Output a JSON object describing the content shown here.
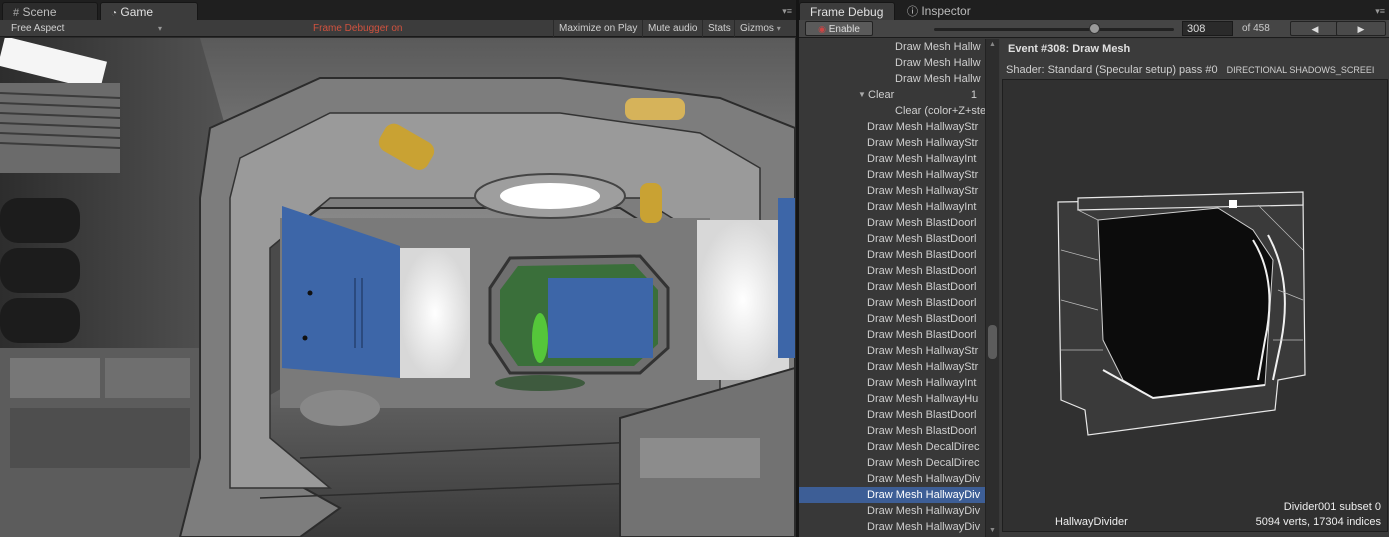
{
  "left_tabs": {
    "scene": "Scene",
    "game": "Game"
  },
  "game_toolbar": {
    "aspect": "Free Aspect",
    "status": "Frame Debugger on",
    "maximize": "Maximize on Play",
    "mute": "Mute audio",
    "stats": "Stats",
    "gizmos": "Gizmos"
  },
  "right_tabs": {
    "frame_debug": "Frame Debug",
    "inspector": "Inspector"
  },
  "fd_toolbar": {
    "enable": "Enable",
    "event_index": "308",
    "of_total": "of 458",
    "slider_position": 0.672
  },
  "tree_rows": [
    {
      "label": "Draw Mesh Hallw",
      "indent": 2,
      "count": ""
    },
    {
      "label": "Draw Mesh Hallw",
      "indent": 2,
      "count": ""
    },
    {
      "label": "Draw Mesh Hallw",
      "indent": 2,
      "count": ""
    },
    {
      "label": "Clear",
      "indent": 1,
      "count": "1",
      "expanded": true
    },
    {
      "label": "Clear (color+Z+ste",
      "indent": 2,
      "count": ""
    },
    {
      "label": "Draw Mesh HallwayStr",
      "indent": 0,
      "count": ""
    },
    {
      "label": "Draw Mesh HallwayStr",
      "indent": 0,
      "count": ""
    },
    {
      "label": "Draw Mesh HallwayInt",
      "indent": 0,
      "count": ""
    },
    {
      "label": "Draw Mesh HallwayStr",
      "indent": 0,
      "count": ""
    },
    {
      "label": "Draw Mesh HallwayStr",
      "indent": 0,
      "count": ""
    },
    {
      "label": "Draw Mesh HallwayInt",
      "indent": 0,
      "count": ""
    },
    {
      "label": "Draw Mesh BlastDoorl",
      "indent": 0,
      "count": ""
    },
    {
      "label": "Draw Mesh BlastDoorl",
      "indent": 0,
      "count": ""
    },
    {
      "label": "Draw Mesh BlastDoorl",
      "indent": 0,
      "count": ""
    },
    {
      "label": "Draw Mesh BlastDoorl",
      "indent": 0,
      "count": ""
    },
    {
      "label": "Draw Mesh BlastDoorl",
      "indent": 0,
      "count": ""
    },
    {
      "label": "Draw Mesh BlastDoorl",
      "indent": 0,
      "count": ""
    },
    {
      "label": "Draw Mesh BlastDoorl",
      "indent": 0,
      "count": ""
    },
    {
      "label": "Draw Mesh BlastDoorl",
      "indent": 0,
      "count": ""
    },
    {
      "label": "Draw Mesh HallwayStr",
      "indent": 0,
      "count": ""
    },
    {
      "label": "Draw Mesh HallwayStr",
      "indent": 0,
      "count": ""
    },
    {
      "label": "Draw Mesh HallwayInt",
      "indent": 0,
      "count": ""
    },
    {
      "label": "Draw Mesh HallwayHu",
      "indent": 0,
      "count": ""
    },
    {
      "label": "Draw Mesh BlastDoorl",
      "indent": 0,
      "count": ""
    },
    {
      "label": "Draw Mesh BlastDoorl",
      "indent": 0,
      "count": ""
    },
    {
      "label": "Draw Mesh DecalDirec",
      "indent": 0,
      "count": ""
    },
    {
      "label": "Draw Mesh DecalDirec",
      "indent": 0,
      "count": ""
    },
    {
      "label": "Draw Mesh HallwayDiv",
      "indent": 0,
      "count": ""
    },
    {
      "label": "Draw Mesh HallwayDiv",
      "indent": 0,
      "count": "",
      "selected": true
    },
    {
      "label": "Draw Mesh HallwayDiv",
      "indent": 0,
      "count": ""
    },
    {
      "label": "Draw Mesh HallwayDiv",
      "indent": 0,
      "count": ""
    },
    {
      "label": "Draw Mesh HallwayDiv",
      "indent": 0,
      "count": ""
    }
  ],
  "detail": {
    "event_title": "Event #308: Draw Mesh",
    "shader_line": "Shader: Standard (Specular setup) pass #0",
    "keywords": "DIRECTIONAL SHADOWS_SCREEI",
    "mesh_name": "HallwayDivider",
    "subset": "Divider001 subset 0",
    "stats": "5094 verts, 17304 indices"
  },
  "colors": {
    "selection": "#3d5e96",
    "status_red": "#d0523f",
    "blue_wall": "#3d66a8",
    "green_glow": "#55c63a"
  }
}
